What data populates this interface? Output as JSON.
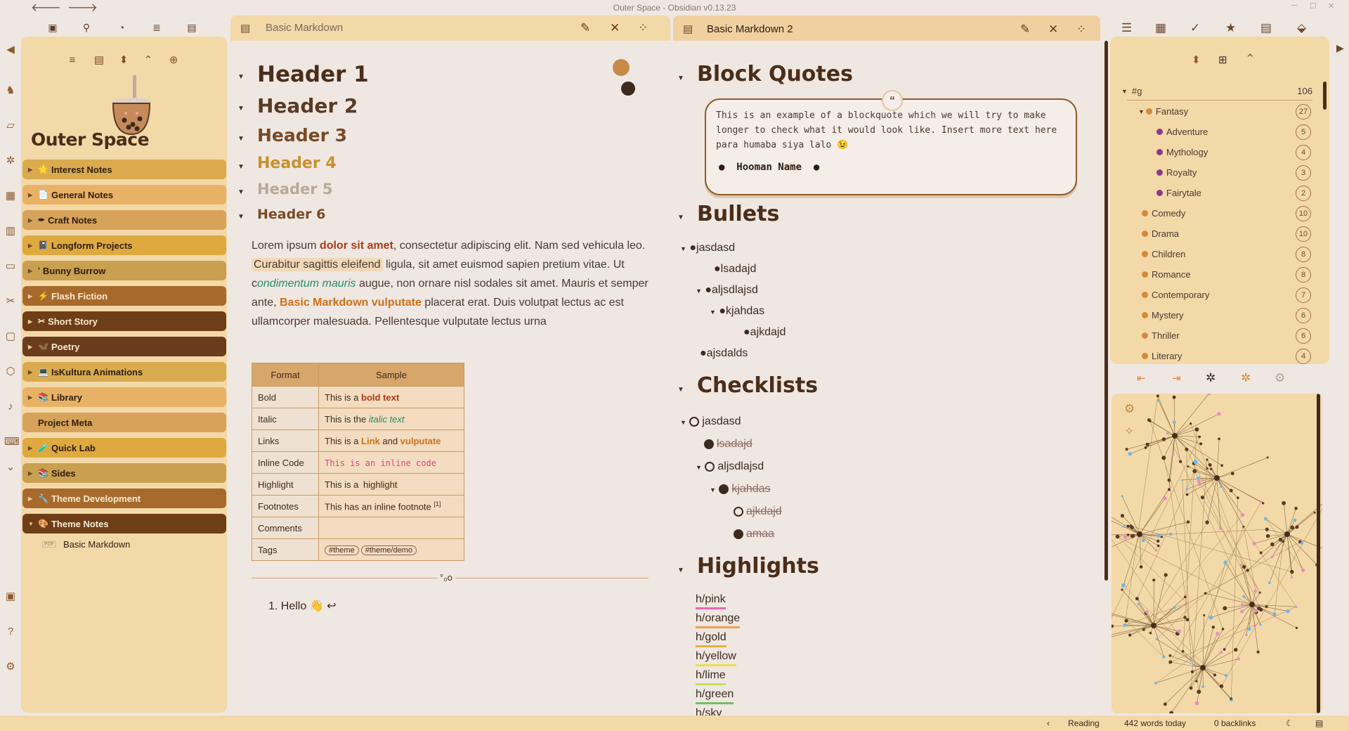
{
  "window": {
    "title": "Outer Space - Obsidian v0.13.23"
  },
  "left_sidebar": {
    "app_name": "Outer Space",
    "folders": [
      {
        "label": "Interest Notes",
        "icon": "🌟"
      },
      {
        "label": "General Notes",
        "icon": "📄"
      },
      {
        "label": "Craft Notes",
        "icon": "✒"
      },
      {
        "label": "Longform Projects",
        "icon": "📓"
      },
      {
        "label": "Bunny Burrow",
        "icon": "'"
      },
      {
        "label": "Flash Fiction",
        "icon": "⚡"
      },
      {
        "label": "Short Story",
        "icon": "✂"
      },
      {
        "label": "Poetry",
        "icon": "🦋"
      },
      {
        "label": "IsKultura Animations",
        "icon": "💻"
      },
      {
        "label": "Library",
        "icon": "📚"
      },
      {
        "label": "Project Meta",
        "icon": ""
      },
      {
        "label": "Quick Lab",
        "icon": "🧪"
      },
      {
        "label": "Sides",
        "icon": "📚"
      },
      {
        "label": "Theme Development",
        "icon": "🔧"
      },
      {
        "label": "Theme Notes",
        "icon": "🎨"
      }
    ],
    "file": {
      "label": "Basic Markdown",
      "badge": "PDF"
    }
  },
  "pane1": {
    "tab_title": "Basic Markdown",
    "headers": [
      "Header 1",
      "Header 2",
      "Header 3",
      "Header 4",
      "Header 5",
      "Header 6"
    ],
    "para": {
      "t1": "Lorem ipsum ",
      "bold_red": "dolor sit amet",
      "t2": ", consectetur adipiscing elit. Nam sed vehicula leo. ",
      "highlight": "Curabitur sagittis eleifend",
      "t3": " ligula, sit amet euismod sapien pretium vitae. Ut c",
      "italic": "ondimentum mauris",
      "t4": " augue, non ornare nisl sodales sit amet. Mauris et semper ante, ",
      "bold_orange": "Basic Markdown vulputate",
      "t5": " placerat erat. Duis volutpat lectus ac est ullamcorper malesuada. Pellentesque vulputate lectus urna"
    },
    "table": {
      "headers": [
        "Format",
        "Sample"
      ],
      "rows": {
        "bold": {
          "k": "Bold",
          "pre": "This is a ",
          "v": "bold text"
        },
        "italic": {
          "k": "Italic",
          "pre": "This is the ",
          "v": "italic text"
        },
        "links": {
          "k": "Links",
          "pre": "This is a ",
          "v1": "Link",
          "mid": " and ",
          "v2": "vulputate"
        },
        "code": {
          "k": "Inline Code",
          "v": "This is an inline code"
        },
        "highlight": {
          "k": "Highlight",
          "pre": "This is a ",
          "v": "highlight"
        },
        "footnotes": {
          "k": "Footnotes",
          "pre": "This has an inline footnote ",
          "sup": "[1]"
        },
        "comments": {
          "k": "Comments"
        },
        "tags": {
          "k": "Tags",
          "t1": "#theme",
          "t2": "#theme/demo"
        }
      }
    },
    "divider_glyph": "°₀o",
    "footnote": {
      "num": "1.",
      "text": "Hello 👋 ↩"
    }
  },
  "pane2": {
    "tab_title": "Basic Markdown 2",
    "sections": {
      "blockquotes": "Block Quotes",
      "bullets": "Bullets",
      "checklists": "Checklists",
      "highlights": "Highlights"
    },
    "quote": {
      "mark": "“",
      "text": "This is an example of a blockquote which we will try to make longer to check what it would look like. Insert more text here para humaba siya lalo 😉",
      "author": "Hooman Name"
    },
    "bullets": [
      "jasdasd",
      "lsadajd",
      "aljsdlajsd",
      "kjahdas",
      "ajkdajd",
      "ajsdalds"
    ],
    "checklist": [
      "jasdasd",
      "lsadajd",
      "aljsdlajsd",
      "kjahdas",
      "ajkdajd",
      "amaa"
    ],
    "highlights": [
      {
        "label": "h/pink",
        "color": "#e868b8"
      },
      {
        "label": "h/orange",
        "color": "#f0a050"
      },
      {
        "label": "h/gold",
        "color": "#e8b040"
      },
      {
        "label": "h/yellow",
        "color": "#e8e050"
      },
      {
        "label": "h/lime",
        "color": "#c8e060"
      },
      {
        "label": "h/green",
        "color": "#70c060"
      },
      {
        "label": "h/sky",
        "color": "#70b8e8"
      }
    ]
  },
  "tags_panel": {
    "root": {
      "label": "#g",
      "count": "106"
    },
    "items": [
      {
        "label": "Fantasy",
        "count": "27"
      },
      {
        "label": "Adventure",
        "count": "5"
      },
      {
        "label": "Mythology",
        "count": "4"
      },
      {
        "label": "Royalty",
        "count": "3"
      },
      {
        "label": "Fairytale",
        "count": "2"
      },
      {
        "label": "Comedy",
        "count": "10"
      },
      {
        "label": "Drama",
        "count": "10"
      },
      {
        "label": "Children",
        "count": "8"
      },
      {
        "label": "Romance",
        "count": "8"
      },
      {
        "label": "Contemporary",
        "count": "7"
      },
      {
        "label": "Mystery",
        "count": "6"
      },
      {
        "label": "Thriller",
        "count": "6"
      },
      {
        "label": "Literary",
        "count": "4"
      }
    ]
  },
  "status_bar": {
    "mode": "Reading",
    "words": "442 words today",
    "backlinks": "0 backlinks"
  },
  "colors": {
    "accent": "#8b5a2b",
    "panel": "#f3d9a8",
    "bg": "#efe7e2"
  }
}
